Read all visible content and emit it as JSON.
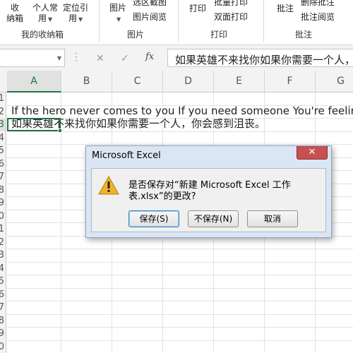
{
  "ribbon": {
    "btn_shou_l1": "收",
    "btn_shou_l2": "纳箱",
    "btn_personal_l1": "个人常",
    "btn_personal_l2": "用",
    "btn_locate_l1": "定位引",
    "btn_locate_l2": "用",
    "btn_picture": "图片",
    "btn_screenshot": "选区截图",
    "btn_picbrowse": "图片阅览",
    "btn_print": "打印",
    "btn_batchprint": "批量打印",
    "btn_duplex": "双面打印",
    "btn_comment": "批注",
    "btn_delcomment": "删除批注",
    "btn_browsecomment": "批注阅览",
    "group_box": "我的收纳箱",
    "group_picture": "图片",
    "group_print": "打印",
    "group_comment": "批注"
  },
  "formula_bar": {
    "name_box": "",
    "fx": "fx",
    "cancel_glyph": "✕",
    "enter_glyph": "✓",
    "content": "如果英雄不来找你如果你需要一个人，"
  },
  "grid": {
    "columns": [
      "A",
      "B",
      "C",
      "D",
      "E",
      "F",
      "G"
    ],
    "selected_column": "A",
    "rows": [
      "1",
      "2",
      "3",
      "4",
      "5",
      "6",
      "7",
      "8",
      "9",
      "0",
      "1",
      "2",
      "3",
      "4",
      "5",
      "6",
      "7",
      "8",
      "9",
      "0"
    ],
    "cell_row2": "If the hero never comes to you If you need someone You're feeling blue.",
    "cell_row3": "如果英雄不来找你如果你需要一个人，你会感到沮丧。"
  },
  "dialog": {
    "title": "Microsoft Excel",
    "message": "是否保存对“新建 Microsoft Excel 工作表.xlsx”的更改?",
    "btn_save": "保存(S)",
    "btn_nosave": "不保存(N)",
    "btn_cancel": "取消"
  },
  "colors": {
    "accent": "#217346",
    "dialog_frame": "#dbe6f4",
    "close_button": "#c75050",
    "warning": "#f0b429"
  }
}
